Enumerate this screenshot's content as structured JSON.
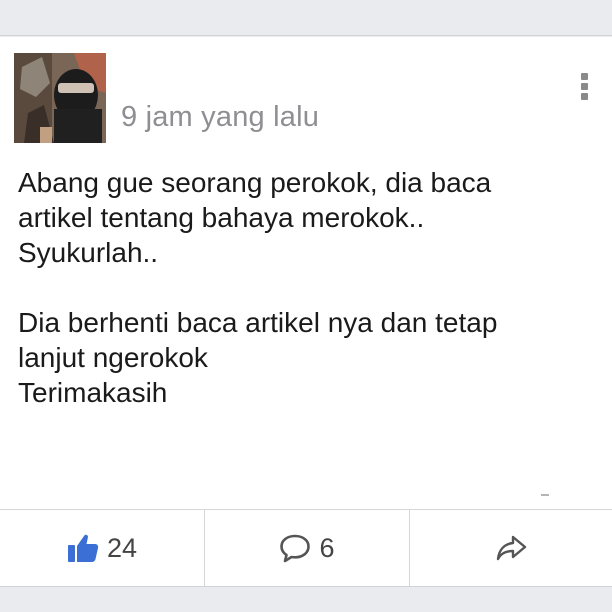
{
  "post": {
    "timestamp": "9 jam yang lalu",
    "lines": [
      "Abang gue seorang perokok, dia baca",
      "artikel tentang bahaya merokok..",
      "Syukurlah..",
      "",
      "Dia berhenti baca artikel nya dan tetap",
      "lanjut ngerokok",
      "Terimakasih"
    ]
  },
  "actions": {
    "like_count": "24",
    "comment_count": "6"
  },
  "icons": {
    "more": "more-vertical-icon",
    "like": "thumbs-up-icon",
    "comment": "comment-bubble-icon",
    "share": "share-arrow-icon"
  },
  "colors": {
    "like_accent": "#3b6fd6",
    "icon_gray": "#555555",
    "text": "#1a1a1a",
    "timestamp": "#8e8e93"
  }
}
